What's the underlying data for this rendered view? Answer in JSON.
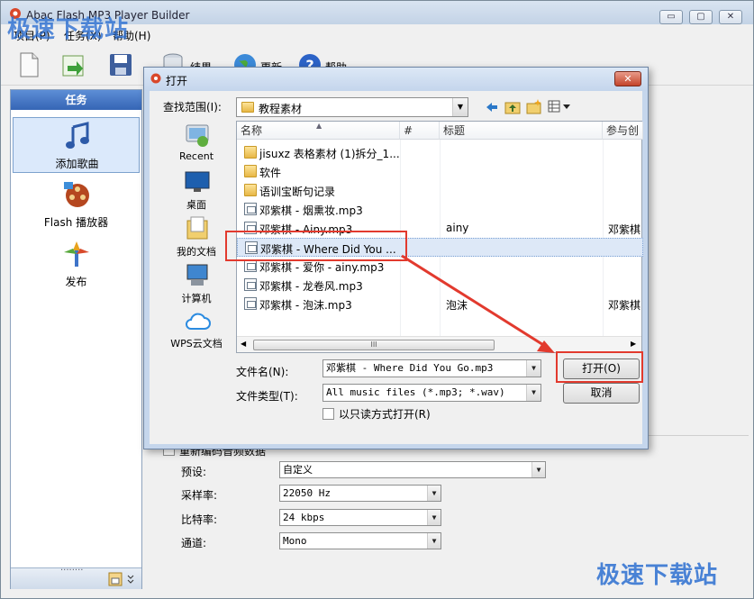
{
  "app": {
    "title": "Abac Flash MP3 Player Builder",
    "window_buttons": [
      "▭",
      "▢",
      "✕"
    ],
    "menu": [
      "项目(P)",
      "任务(X)",
      "帮助(H)"
    ],
    "toolbar": [
      {
        "icon": "new-file-icon",
        "label": ""
      },
      {
        "icon": "import-arrow-icon",
        "label": ""
      },
      {
        "icon": "save-icon",
        "label": ""
      },
      {
        "icon": "database-icon",
        "label": "结果"
      },
      {
        "icon": "globe-icon",
        "label": "更新"
      },
      {
        "icon": "help-icon",
        "label": "帮助"
      }
    ]
  },
  "left_pane": {
    "header": "任务",
    "tasks": [
      {
        "icon": "music-note-icon",
        "label": "添加歌曲",
        "selected": true
      },
      {
        "icon": "film-reel-icon",
        "label": "Flash 播放器",
        "selected": false
      },
      {
        "icon": "publish-icon",
        "label": "发布",
        "selected": false
      }
    ],
    "footer_dots": "........"
  },
  "main_settings": {
    "section_label": "重新编码音频数据",
    "fields": [
      {
        "label": "预设:",
        "value": "自定义"
      },
      {
        "label": "采样率:",
        "value": "22050 Hz"
      },
      {
        "label": "比特率:",
        "value": "24 kbps"
      },
      {
        "label": "通道:",
        "value": "Mono"
      }
    ]
  },
  "dialog": {
    "title": "打开",
    "close_label": "✕",
    "look_in_label": "查找范围(I):",
    "look_in_value": "教程素材",
    "places": [
      {
        "icon": "recent-icon",
        "label": "Recent"
      },
      {
        "icon": "desktop-icon",
        "label": "桌面"
      },
      {
        "icon": "my-documents-icon",
        "label": "我的文档"
      },
      {
        "icon": "computer-icon",
        "label": "计算机"
      },
      {
        "icon": "wps-cloud-icon",
        "label": "WPS云文档"
      }
    ],
    "columns": [
      "名称",
      "#",
      "标题",
      "参与创"
    ],
    "files": [
      {
        "type": "folder",
        "name": "jisuxz 表格素材 (1)拆分_1...",
        "title": "",
        "artist": ""
      },
      {
        "type": "folder",
        "name": "软件",
        "title": "",
        "artist": ""
      },
      {
        "type": "folder",
        "name": "语训宝断句记录",
        "title": "",
        "artist": ""
      },
      {
        "type": "mp3",
        "name": "邓紫棋 - 烟熏妆.mp3",
        "title": "",
        "artist": ""
      },
      {
        "type": "mp3",
        "name": "邓紫棋 - Ainy.mp3",
        "title": "ainy",
        "artist": "邓紫棋"
      },
      {
        "type": "mp3",
        "name": "邓紫棋 - Where Did You ...",
        "title": "",
        "artist": ""
      },
      {
        "type": "mp3",
        "name": "邓紫棋 - 爱你 - ainy.mp3",
        "title": "",
        "artist": ""
      },
      {
        "type": "mp3",
        "name": "邓紫棋 - 龙卷风.mp3",
        "title": "",
        "artist": ""
      },
      {
        "type": "mp3",
        "name": "邓紫棋 - 泡沫.mp3",
        "title": "泡沫",
        "artist": "邓紫棋"
      }
    ],
    "scroll_grip": "III",
    "filename_label": "文件名(N):",
    "filename_value": "邓紫棋 - Where Did You Go.mp3",
    "filetype_label": "文件类型(T):",
    "filetype_value": "All music files (*.mp3; *.wav)",
    "readonly_label": "以只读方式打开(R)",
    "open_button": "打开(O)",
    "cancel_button": "取消"
  },
  "watermark": "极速下载站",
  "colors": {
    "annotation_red": "#e23a2e",
    "selection": "#dde8f7",
    "pane_header": "#3f6fbe"
  }
}
